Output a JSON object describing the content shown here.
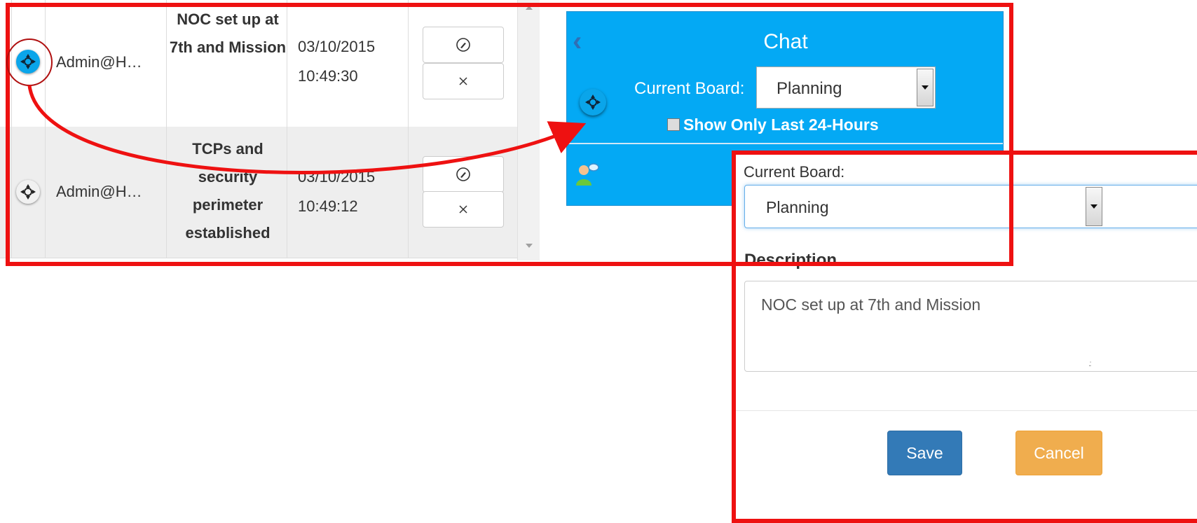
{
  "table": {
    "rows": [
      {
        "user": "Admin@H…",
        "description": "NOC set up at 7th and Mission",
        "date": "03/10/2015",
        "time": "10:49:30"
      },
      {
        "user": "Admin@H…",
        "description": "TCPs and security perimeter established",
        "date": "03/10/2015",
        "time": "10:49:12"
      }
    ]
  },
  "chat": {
    "title": "Chat",
    "board_label": "Current Board:",
    "board_value": "Planning",
    "filter_label": "Show Only Last 24-Hours"
  },
  "dialog": {
    "board_label": "Current Board:",
    "board_value": "Planning",
    "description_label": "Description",
    "description_value": "NOC set up at 7th and Mission",
    "save_label": "Save",
    "cancel_label": "Cancel"
  },
  "colors": {
    "chat_background": "#04a9f4",
    "annotation_red": "#ee1111",
    "save_button": "#337ab7",
    "cancel_button": "#f0ad4e"
  },
  "icons": {
    "locate": "crosshair-locate-icon",
    "edit": "compass-edit-icon",
    "delete": "close-icon",
    "chat_user": "chat-user-icon",
    "back": "chevron-left-icon"
  }
}
